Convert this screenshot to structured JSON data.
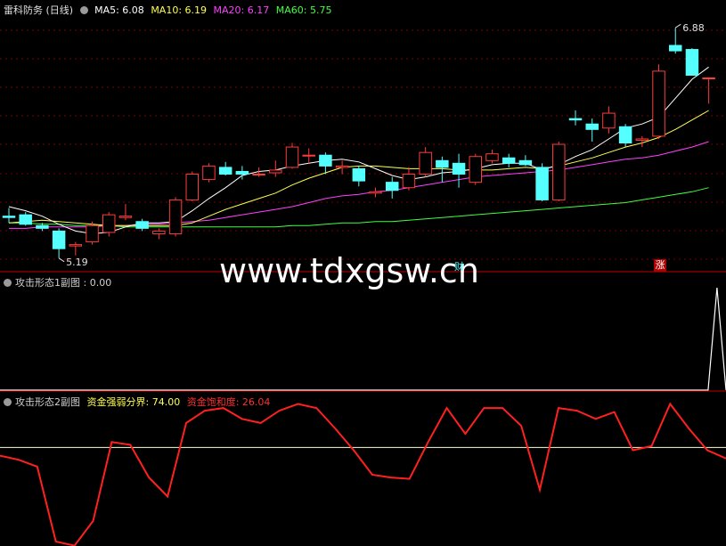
{
  "colors": {
    "up": "#ff3b3b",
    "down": "#54ffff",
    "grid": "#7a0000",
    "sep": "#c00000",
    "ma5": "#ffffff",
    "ma10": "#ffff50",
    "ma20": "#ff40ff",
    "ma60": "#40ff40"
  },
  "panel1": {
    "title": "雷科防务 (日线)",
    "ma5": "MA5: 6.08",
    "ma10": "MA10: 6.19",
    "ma20": "MA20: 6.17",
    "ma60": "MA60: 5.75"
  },
  "watermark": "www.tdxgsw.cn",
  "markers": {
    "cai": "财",
    "zhang": "涨"
  },
  "panel2": {
    "title": "攻击形态1副图 : 0.00"
  },
  "panel3": {
    "title": "攻击形态2副图",
    "line1": "资金强弱分界: 74.00",
    "line2": "资金饱和度: 26.04"
  },
  "chart_data": [
    {
      "type": "candlestick",
      "ohlc": [
        [
          5.49,
          5.55,
          5.44,
          5.48
        ],
        [
          5.5,
          5.52,
          5.42,
          5.43
        ],
        [
          5.42,
          5.44,
          5.38,
          5.4
        ],
        [
          5.38,
          5.4,
          5.18,
          5.25
        ],
        [
          5.27,
          5.3,
          5.2,
          5.28
        ],
        [
          5.3,
          5.45,
          5.28,
          5.42
        ],
        [
          5.37,
          5.52,
          5.34,
          5.5
        ],
        [
          5.48,
          5.58,
          5.46,
          5.49
        ],
        [
          5.45,
          5.47,
          5.38,
          5.4
        ],
        [
          5.36,
          5.4,
          5.32,
          5.38
        ],
        [
          5.36,
          5.63,
          5.34,
          5.61
        ],
        [
          5.61,
          5.82,
          5.6,
          5.8
        ],
        [
          5.76,
          5.88,
          5.74,
          5.86
        ],
        [
          5.85,
          5.89,
          5.79,
          5.8
        ],
        [
          5.82,
          5.86,
          5.76,
          5.8
        ],
        [
          5.8,
          5.85,
          5.78,
          5.8
        ],
        [
          5.81,
          5.9,
          5.78,
          5.83
        ],
        [
          5.85,
          6.03,
          5.84,
          6.0
        ],
        [
          5.94,
          5.99,
          5.88,
          5.94
        ],
        [
          5.94,
          5.96,
          5.8,
          5.86
        ],
        [
          5.85,
          5.9,
          5.8,
          5.86
        ],
        [
          5.84,
          5.86,
          5.71,
          5.75
        ],
        [
          5.66,
          5.7,
          5.63,
          5.67
        ],
        [
          5.74,
          5.78,
          5.62,
          5.68
        ],
        [
          5.7,
          5.85,
          5.68,
          5.8
        ],
        [
          5.8,
          6.0,
          5.78,
          5.96
        ],
        [
          5.9,
          5.93,
          5.74,
          5.85
        ],
        [
          5.88,
          5.95,
          5.7,
          5.8
        ],
        [
          5.74,
          5.95,
          5.72,
          5.93
        ],
        [
          5.9,
          5.98,
          5.88,
          5.95
        ],
        [
          5.92,
          5.95,
          5.85,
          5.88
        ],
        [
          5.9,
          5.94,
          5.86,
          5.87
        ],
        [
          5.85,
          5.88,
          5.6,
          5.61
        ],
        [
          5.61,
          6.04,
          5.6,
          6.02
        ],
        [
          6.21,
          6.27,
          6.16,
          6.2
        ],
        [
          6.17,
          6.21,
          6.04,
          6.13
        ],
        [
          6.14,
          6.3,
          6.1,
          6.25
        ],
        [
          6.15,
          6.17,
          6.0,
          6.03
        ],
        [
          6.05,
          6.08,
          6.0,
          6.06
        ],
        [
          6.08,
          6.61,
          6.06,
          6.56
        ],
        [
          6.75,
          6.88,
          6.69,
          6.71
        ],
        [
          6.72,
          6.73,
          6.53,
          6.53
        ],
        [
          6.51,
          6.51,
          6.32,
          6.51
        ]
      ],
      "ma5": [
        5.56,
        5.53,
        5.49,
        5.43,
        5.38,
        5.36,
        5.37,
        5.41,
        5.44,
        5.44,
        5.45,
        5.53,
        5.62,
        5.7,
        5.79,
        5.82,
        5.83,
        5.86,
        5.88,
        5.9,
        5.91,
        5.89,
        5.84,
        5.79,
        5.76,
        5.78,
        5.81,
        5.82,
        5.84,
        5.87,
        5.88,
        5.88,
        5.83,
        5.87,
        5.93,
        5.98,
        6.06,
        6.14,
        6.17,
        6.22,
        6.36,
        6.5,
        6.59
      ],
      "ma10": [
        5.44,
        5.45,
        5.46,
        5.45,
        5.44,
        5.43,
        5.42,
        5.42,
        5.42,
        5.42,
        5.42,
        5.44,
        5.49,
        5.54,
        5.58,
        5.62,
        5.66,
        5.72,
        5.77,
        5.81,
        5.85,
        5.86,
        5.86,
        5.85,
        5.84,
        5.84,
        5.84,
        5.83,
        5.83,
        5.83,
        5.84,
        5.85,
        5.84,
        5.86,
        5.89,
        5.92,
        5.96,
        6.0,
        6.03,
        6.07,
        6.13,
        6.2,
        6.27
      ],
      "ma20": [
        5.4,
        5.4,
        5.41,
        5.41,
        5.41,
        5.41,
        5.42,
        5.42,
        5.43,
        5.43,
        5.44,
        5.45,
        5.46,
        5.48,
        5.5,
        5.52,
        5.54,
        5.56,
        5.59,
        5.62,
        5.64,
        5.65,
        5.67,
        5.68,
        5.7,
        5.72,
        5.74,
        5.76,
        5.78,
        5.79,
        5.8,
        5.81,
        5.82,
        5.83,
        5.85,
        5.87,
        5.89,
        5.91,
        5.92,
        5.94,
        5.97,
        6.0,
        6.04
      ],
      "ma60": [
        5.44,
        5.44,
        5.43,
        5.43,
        5.42,
        5.42,
        5.42,
        5.41,
        5.41,
        5.41,
        5.41,
        5.41,
        5.41,
        5.41,
        5.41,
        5.41,
        5.41,
        5.42,
        5.42,
        5.43,
        5.44,
        5.44,
        5.45,
        5.45,
        5.46,
        5.47,
        5.48,
        5.49,
        5.5,
        5.51,
        5.52,
        5.53,
        5.54,
        5.55,
        5.56,
        5.57,
        5.58,
        5.59,
        5.61,
        5.63,
        5.65,
        5.67,
        5.7
      ],
      "high_label": "6.88",
      "low_label": "5.19",
      "ylim": [
        5.1,
        6.98
      ]
    },
    {
      "type": "line",
      "ylim": [
        0,
        1.0
      ],
      "series": [
        {
          "values": [
            0,
            0,
            0,
            0,
            0,
            0,
            0,
            0,
            0,
            0,
            0,
            0,
            0,
            0,
            0,
            0,
            0,
            0,
            0,
            0,
            0,
            0,
            0,
            0,
            0,
            0,
            0,
            0,
            0,
            0,
            0,
            0,
            0,
            0,
            0,
            0,
            0,
            0,
            0,
            0,
            0,
            0,
            0,
            0,
            0,
            0,
            0,
            0,
            0,
            0,
            0,
            0,
            0,
            0,
            0,
            0,
            0,
            0,
            0,
            0,
            0,
            0,
            0,
            0,
            0,
            0,
            0,
            0,
            0,
            0,
            0,
            0,
            0,
            0,
            0,
            0,
            0,
            0,
            0,
            0,
            1,
            0
          ]
        }
      ],
      "x_count": 82,
      "peak_index": 80
    },
    {
      "type": "line",
      "ylim": [
        5,
        105
      ],
      "threshold": 74,
      "series": [
        {
          "values": [
            68,
            65,
            60,
            5,
            2,
            20,
            78,
            76,
            52,
            38,
            92,
            101,
            103,
            95,
            92,
            101,
            106,
            103,
            88,
            72,
            54,
            52,
            51,
            78,
            103,
            84,
            103,
            103,
            90,
            43,
            103,
            101,
            95,
            100,
            72,
            75,
            106,
            88,
            72,
            66
          ]
        }
      ]
    }
  ]
}
